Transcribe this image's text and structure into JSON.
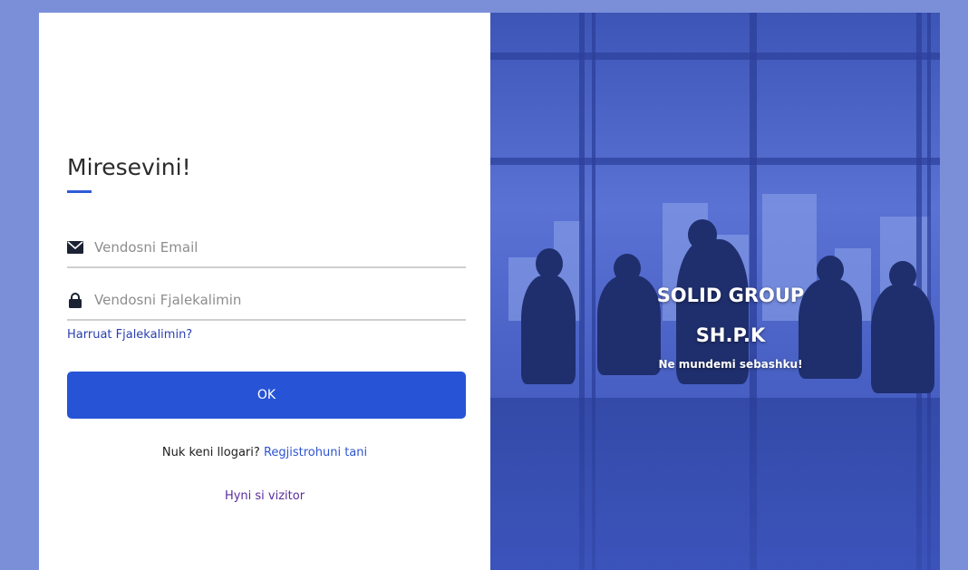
{
  "login": {
    "title": "Miresevini!",
    "email_placeholder": "Vendosni Email",
    "password_placeholder": "Vendosni Fjalekalimin",
    "forgot_label": "Harruat Fjalekalimin?",
    "ok_label": "OK",
    "no_account_text": "Nuk keni llogari?",
    "register_link": "Regjistrohuni tani",
    "visitor_link": "Hyni si vizitor"
  },
  "banner": {
    "company_line1": "SOLID GROUP",
    "company_line2": "SH.P.K",
    "slogan": "Ne mundemi sebashku!"
  },
  "colors": {
    "background": "#7b8fd9",
    "accent": "#2754d6",
    "link": "#2d55cf",
    "visitor_link": "#5b2c9e"
  },
  "icons": {
    "email": "envelope-icon",
    "password": "lock-icon"
  }
}
